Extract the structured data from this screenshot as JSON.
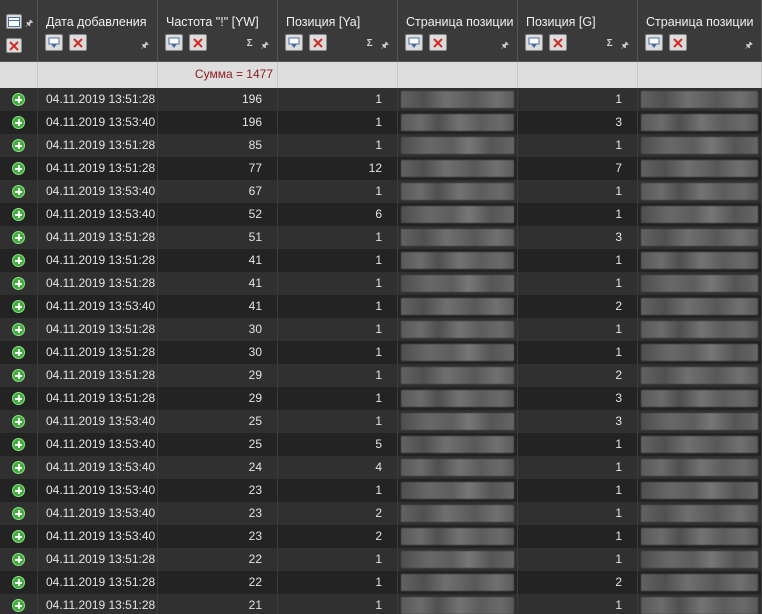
{
  "header": {
    "columns": [
      {
        "title": "Дата добавления",
        "sigma": ""
      },
      {
        "title": "Частота \"!\" [YW]",
        "sigma": "Σ"
      },
      {
        "title": "Позиция [Ya]",
        "sigma": "Σ"
      },
      {
        "title": "Страница позиции",
        "sigma": ""
      },
      {
        "title": "Позиция [G]",
        "sigma": "Σ"
      },
      {
        "title": "Страница позиции",
        "sigma": ""
      }
    ]
  },
  "sum_row": {
    "label": "Сумма = 1477"
  },
  "rows": [
    {
      "date": "04.11.2019 13:51:28",
      "freq": "196",
      "pos_ya": "1",
      "pos_g": "1"
    },
    {
      "date": "04.11.2019 13:53:40",
      "freq": "196",
      "pos_ya": "1",
      "pos_g": "3"
    },
    {
      "date": "04.11.2019 13:51:28",
      "freq": "85",
      "pos_ya": "1",
      "pos_g": "1"
    },
    {
      "date": "04.11.2019 13:51:28",
      "freq": "77",
      "pos_ya": "12",
      "pos_g": "7"
    },
    {
      "date": "04.11.2019 13:53:40",
      "freq": "67",
      "pos_ya": "1",
      "pos_g": "1"
    },
    {
      "date": "04.11.2019 13:53:40",
      "freq": "52",
      "pos_ya": "6",
      "pos_g": "1"
    },
    {
      "date": "04.11.2019 13:51:28",
      "freq": "51",
      "pos_ya": "1",
      "pos_g": "3"
    },
    {
      "date": "04.11.2019 13:51:28",
      "freq": "41",
      "pos_ya": "1",
      "pos_g": "1"
    },
    {
      "date": "04.11.2019 13:51:28",
      "freq": "41",
      "pos_ya": "1",
      "pos_g": "1"
    },
    {
      "date": "04.11.2019 13:53:40",
      "freq": "41",
      "pos_ya": "1",
      "pos_g": "2"
    },
    {
      "date": "04.11.2019 13:51:28",
      "freq": "30",
      "pos_ya": "1",
      "pos_g": "1"
    },
    {
      "date": "04.11.2019 13:51:28",
      "freq": "30",
      "pos_ya": "1",
      "pos_g": "1"
    },
    {
      "date": "04.11.2019 13:51:28",
      "freq": "29",
      "pos_ya": "1",
      "pos_g": "2"
    },
    {
      "date": "04.11.2019 13:51:28",
      "freq": "29",
      "pos_ya": "1",
      "pos_g": "3"
    },
    {
      "date": "04.11.2019 13:53:40",
      "freq": "25",
      "pos_ya": "1",
      "pos_g": "3"
    },
    {
      "date": "04.11.2019 13:53:40",
      "freq": "25",
      "pos_ya": "5",
      "pos_g": "1"
    },
    {
      "date": "04.11.2019 13:53:40",
      "freq": "24",
      "pos_ya": "4",
      "pos_g": "1"
    },
    {
      "date": "04.11.2019 13:53:40",
      "freq": "23",
      "pos_ya": "1",
      "pos_g": "1"
    },
    {
      "date": "04.11.2019 13:53:40",
      "freq": "23",
      "pos_ya": "2",
      "pos_g": "1"
    },
    {
      "date": "04.11.2019 13:53:40",
      "freq": "23",
      "pos_ya": "2",
      "pos_g": "1"
    },
    {
      "date": "04.11.2019 13:51:28",
      "freq": "22",
      "pos_ya": "1",
      "pos_g": "1"
    },
    {
      "date": "04.11.2019 13:51:28",
      "freq": "22",
      "pos_ya": "1",
      "pos_g": "2"
    },
    {
      "date": "04.11.2019 13:51:28",
      "freq": "21",
      "pos_ya": "1",
      "pos_g": "1"
    }
  ],
  "icons": {
    "row_action": "add-circle-icon",
    "filter": "filter-icon",
    "clear_filter": "clear-filter-icon",
    "pin": "pin-icon",
    "sum": "sigma-icon"
  },
  "colors": {
    "sum_text": "#8b1a1a",
    "add_icon": "#3fae3a",
    "header_bg": "#3a3a3a",
    "row_odd": "#303030",
    "row_even": "#232323"
  }
}
